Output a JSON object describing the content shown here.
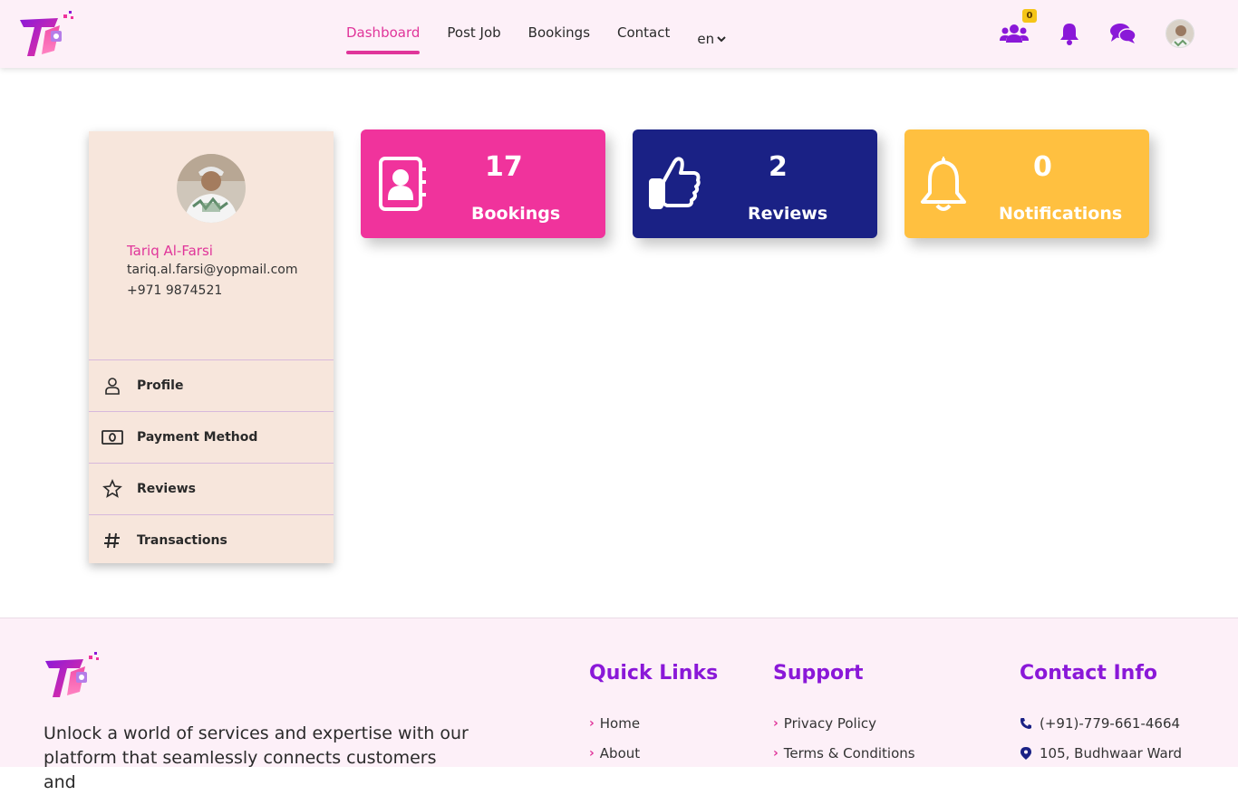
{
  "header": {
    "nav": [
      {
        "label": "Dashboard",
        "active": true
      },
      {
        "label": "Post Job",
        "active": false
      },
      {
        "label": "Bookings",
        "active": false
      },
      {
        "label": "Contact",
        "active": false
      }
    ],
    "lang": "en",
    "badge_count": "0",
    "icons": [
      "users-icon",
      "bell-icon",
      "chat-icon",
      "avatar"
    ]
  },
  "profile": {
    "name": "Tariq Al-Farsi",
    "email": "tariq.al.farsi@yopmail.com",
    "phone": "+971 9874521",
    "menu": [
      {
        "label": "Profile",
        "icon": "user-icon"
      },
      {
        "label": "Payment Method",
        "icon": "money-icon"
      },
      {
        "label": "Reviews",
        "icon": "star-icon"
      },
      {
        "label": "Transactions",
        "icon": "hash-icon"
      }
    ]
  },
  "stats": [
    {
      "value": "17",
      "label": "Bookings",
      "color": "#f0339c",
      "icon": "address-book-icon"
    },
    {
      "value": "2",
      "label": "Reviews",
      "color": "#1a2185",
      "icon": "thumbs-up-icon"
    },
    {
      "value": "0",
      "label": "Notifications",
      "color": "#ffc040",
      "icon": "bell-icon"
    }
  ],
  "footer": {
    "description": "Unlock a world of services and expertise with our platform that seamlessly connects customers and",
    "quick_links_title": "Quick Links",
    "quick_links": [
      "Home",
      "About"
    ],
    "support_title": "Support",
    "support_links": [
      "Privacy Policy",
      "Terms & Conditions"
    ],
    "contact_title": "Contact Info",
    "contact_phone": "(+91)-779-661-4664",
    "contact_address": "105, Budhwaar Ward"
  },
  "colors": {
    "accent": "#e0359a",
    "purple": "#8a18d8"
  }
}
